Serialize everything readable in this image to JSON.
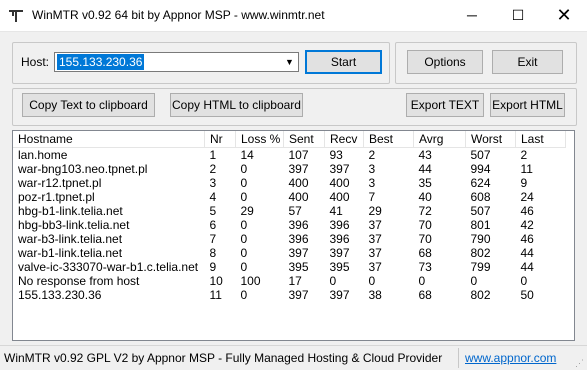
{
  "window": {
    "title": "WinMTR v0.92 64 bit by Appnor MSP - www.winmtr.net",
    "minimize": "─",
    "maximize": "☐",
    "close": "✕"
  },
  "host": {
    "label": "Host:",
    "value": "155.133.230.36",
    "dropdown_icon": "▼"
  },
  "buttons": {
    "start": "Start",
    "options": "Options",
    "exit": "Exit",
    "copy_text": "Copy Text to clipboard",
    "copy_html": "Copy HTML to clipboard",
    "export_text": "Export TEXT",
    "export_html": "Export HTML"
  },
  "table": {
    "columns": [
      "Hostname",
      "Nr",
      "Loss %",
      "Sent",
      "Recv",
      "Best",
      "Avrg",
      "Worst",
      "Last"
    ],
    "rows": [
      [
        "lan.home",
        "1",
        "14",
        "107",
        "93",
        "2",
        "43",
        "507",
        "2"
      ],
      [
        "war-bng103.neo.tpnet.pl",
        "2",
        "0",
        "397",
        "397",
        "3",
        "44",
        "994",
        "11"
      ],
      [
        "war-r12.tpnet.pl",
        "3",
        "0",
        "400",
        "400",
        "3",
        "35",
        "624",
        "9"
      ],
      [
        "poz-r1.tpnet.pl",
        "4",
        "0",
        "400",
        "400",
        "7",
        "40",
        "608",
        "24"
      ],
      [
        "hbg-b1-link.telia.net",
        "5",
        "29",
        "57",
        "41",
        "29",
        "72",
        "507",
        "46"
      ],
      [
        "hbg-bb3-link.telia.net",
        "6",
        "0",
        "396",
        "396",
        "37",
        "70",
        "801",
        "42"
      ],
      [
        "war-b3-link.telia.net",
        "7",
        "0",
        "396",
        "396",
        "37",
        "70",
        "790",
        "46"
      ],
      [
        "war-b1-link.telia.net",
        "8",
        "0",
        "397",
        "397",
        "37",
        "68",
        "802",
        "44"
      ],
      [
        "valve-ic-333070-war-b1.c.telia.net",
        "9",
        "0",
        "395",
        "395",
        "37",
        "73",
        "799",
        "44"
      ],
      [
        "No response from host",
        "10",
        "100",
        "17",
        "0",
        "0",
        "0",
        "0",
        "0"
      ],
      [
        "155.133.230.36",
        "11",
        "0",
        "397",
        "397",
        "38",
        "68",
        "802",
        "50"
      ]
    ]
  },
  "status": {
    "text": "WinMTR v0.92 GPL V2 by Appnor MSP - Fully Managed Hosting & Cloud Provider",
    "link": "www.appnor.com"
  }
}
